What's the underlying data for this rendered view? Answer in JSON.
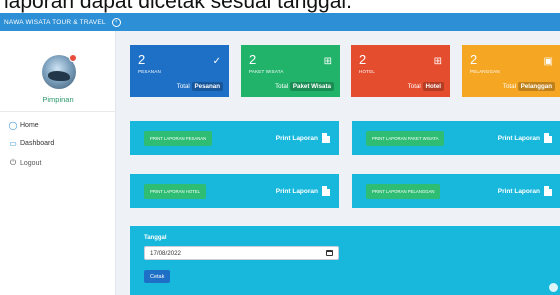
{
  "caption": "laporan dapat dicetak sesuai tanggal.",
  "topbar": {
    "brand": "NAWA WISATA TOUR & TRAVEL",
    "toggle_icon": "arrow-left-circle-icon"
  },
  "sidebar": {
    "user_name": "Pimpinan",
    "items": [
      {
        "label": "Home",
        "icon": "compass-icon"
      },
      {
        "label": "Dashboard",
        "icon": "monitor-icon"
      },
      {
        "label": "Logout",
        "icon": "power-icon"
      }
    ]
  },
  "cards": [
    {
      "count": "2",
      "label": "PESANAN",
      "total": "Total",
      "pill": "Pesanan",
      "icon": "check-circle-icon",
      "color": "#1e6fc6"
    },
    {
      "count": "2",
      "label": "PAKET WISATA",
      "total": "Total",
      "pill": "Paket Wisata",
      "icon": "table-icon",
      "color": "#22b36b"
    },
    {
      "count": "2",
      "label": "HOTEL",
      "total": "Total",
      "pill": "Hotel",
      "icon": "table-icon",
      "color": "#e54d2f"
    },
    {
      "count": "2",
      "label": "PELANGGAN",
      "total": "Total",
      "pill": "Pelanggan",
      "icon": "user-square-icon",
      "color": "#f5a623"
    }
  ],
  "reports": [
    {
      "button": "PRINT LAPORAN PESANAN",
      "link": "Print Laporan"
    },
    {
      "button": "PRINT LAPORAN PAKET WISATA",
      "link": "Print Laporan"
    },
    {
      "button": "PRINT LAPORAN HOTEL",
      "link": "Print Laporan"
    },
    {
      "button": "PRINT LAPORAN PELANGGAN",
      "link": "Print Laporan"
    }
  ],
  "date_form": {
    "label": "Tanggal",
    "value": "17/08/2022",
    "button": "Cetak"
  },
  "colors": {
    "topbar": "#2d8fd6",
    "panel": "#17b8dc",
    "green_button": "#2ebd73"
  }
}
